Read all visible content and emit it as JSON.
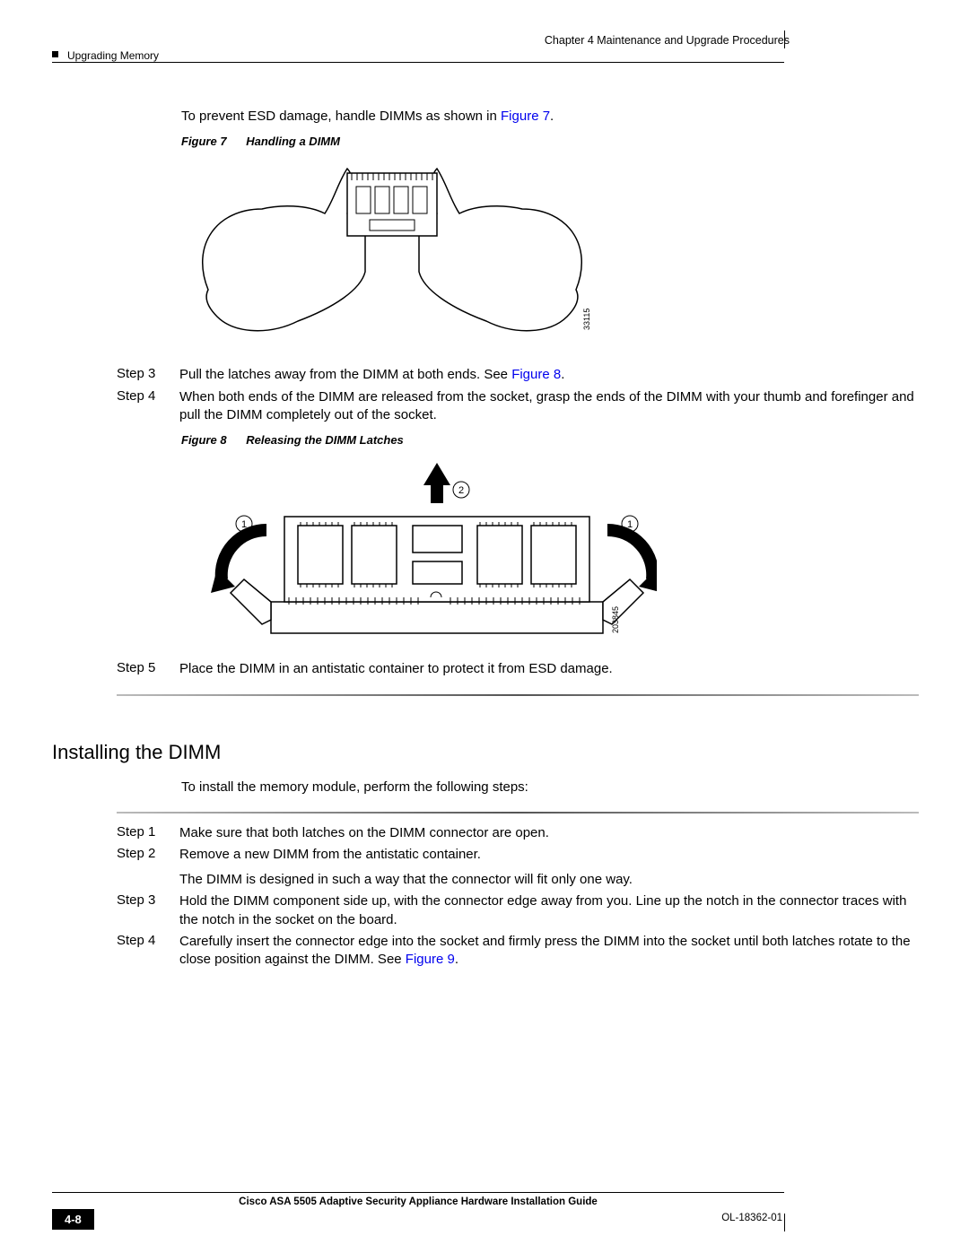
{
  "header": {
    "chapter": "Chapter 4      Maintenance and Upgrade Procedures",
    "section": "Upgrading Memory"
  },
  "intro_text_prefix": "To prevent ESD damage, handle DIMMs as shown in ",
  "intro_ref": "Figure 7",
  "intro_text_suffix": ".",
  "figure7": {
    "label": "Figure 7",
    "title": "Handling a DIMM",
    "id": "33115"
  },
  "steps_a": [
    {
      "label": "Step 3",
      "text_prefix": "Pull the latches away from the DIMM at both ends. See ",
      "ref": "Figure 8",
      "text_suffix": "."
    },
    {
      "label": "Step 4",
      "text": "When both ends of the DIMM are released from the socket, grasp the ends of the DIMM with your thumb and forefinger and pull the DIMM completely out of the socket."
    }
  ],
  "figure8": {
    "label": "Figure 8",
    "title": "Releasing the DIMM Latches",
    "id": "203845",
    "callouts": [
      "1",
      "2",
      "1"
    ]
  },
  "steps_b": [
    {
      "label": "Step 5",
      "text": "Place the DIMM in an antistatic container to protect it from ESD damage."
    }
  ],
  "heading": "Installing the DIMM",
  "install_intro": "To install the memory module, perform the following steps:",
  "steps_c": [
    {
      "label": "Step 1",
      "text": "Make sure that both latches on the DIMM connector are open."
    },
    {
      "label": "Step 2",
      "text": "Remove a new DIMM from the antistatic container.",
      "text2": "The DIMM is designed in such a way that the connector will fit only one way."
    },
    {
      "label": "Step 3",
      "text": "Hold the DIMM component side up, with the connector edge away from you. Line up the notch in the connector traces with the notch in the socket on the board."
    },
    {
      "label": "Step 4",
      "text_prefix": "Carefully insert the connector edge into the socket and firmly press the DIMM into the socket until both latches rotate to the close position against the DIMM. See ",
      "ref": "Figure 9",
      "text_suffix": "."
    }
  ],
  "footer": {
    "title": "Cisco ASA 5505 Adaptive Security Appliance Hardware Installation Guide",
    "page": "4-8",
    "doc": "OL-18362-01"
  }
}
